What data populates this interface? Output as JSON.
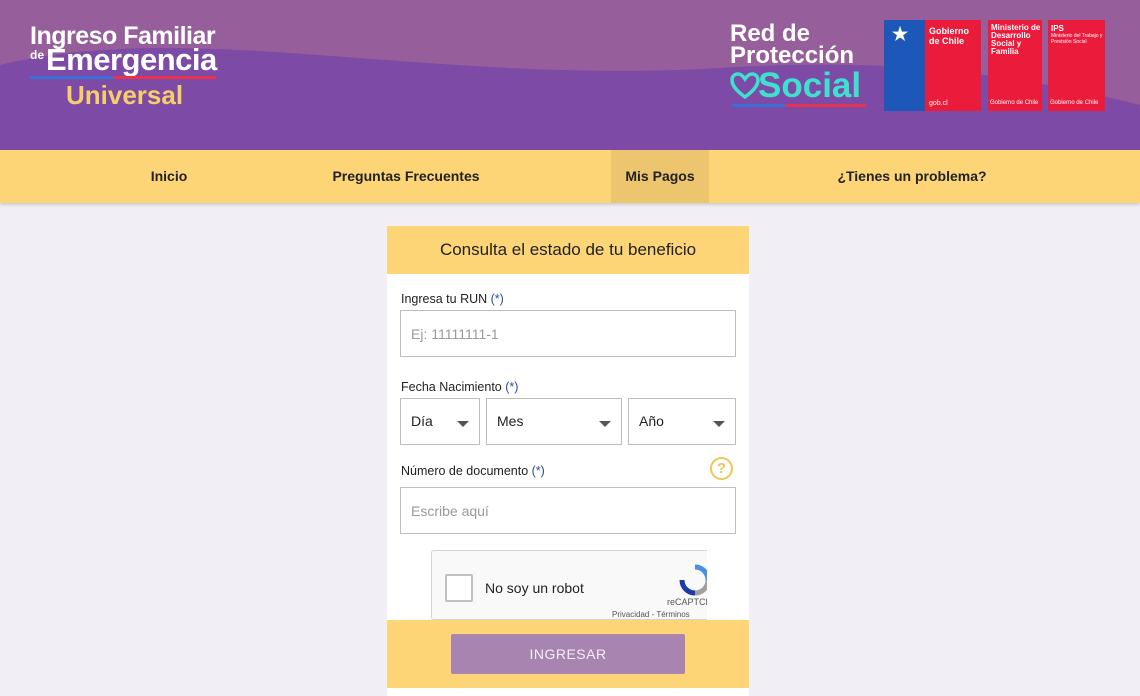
{
  "header": {
    "ife_logo": {
      "line1": "Ingreso Familiar",
      "de": "de",
      "line2": "Emergencia",
      "line3": "Universal"
    },
    "rps_logo": {
      "line1": "Red de",
      "line2": "Protección",
      "line3": "Social"
    },
    "gov_logos": [
      {
        "title": "Gobierno de Chile",
        "footer": "gob.cl"
      },
      {
        "title": "Ministerio de Desarrollo Social y Familia",
        "footer": "Gobierno de Chile"
      },
      {
        "title": "IPS",
        "subtitle": "Ministerio del Trabajo y Previsión Social",
        "footer": "Gobierno de Chile"
      }
    ]
  },
  "nav": {
    "items": [
      "Inicio",
      "Preguntas Frecuentes",
      "Mis Pagos",
      "¿Tienes un problema?"
    ],
    "active": "Mis Pagos"
  },
  "form": {
    "title": "Consulta el estado de tu beneficio",
    "required_mark": "(*)",
    "run": {
      "label": "Ingresa tu RUN",
      "placeholder": "Ej: 11111111-1",
      "value": ""
    },
    "birth": {
      "label": "Fecha Nacimiento",
      "day": "Día",
      "month": "Mes",
      "year": "Año"
    },
    "document": {
      "label": "Número de documento",
      "placeholder": "Escribe aquí",
      "value": ""
    },
    "help_symbol": "?",
    "captcha": {
      "label": "No soy un robot",
      "brand": "reCAPTCHA",
      "links": "Privacidad - Términos",
      "checked": false
    },
    "submit": "INGRESAR"
  },
  "colors": {
    "purple": "#7d4ba6",
    "yellow": "#fdd577",
    "button": "#a785b0",
    "gov_red": "#eb1b3c",
    "gov_blue": "#1d58b8"
  }
}
